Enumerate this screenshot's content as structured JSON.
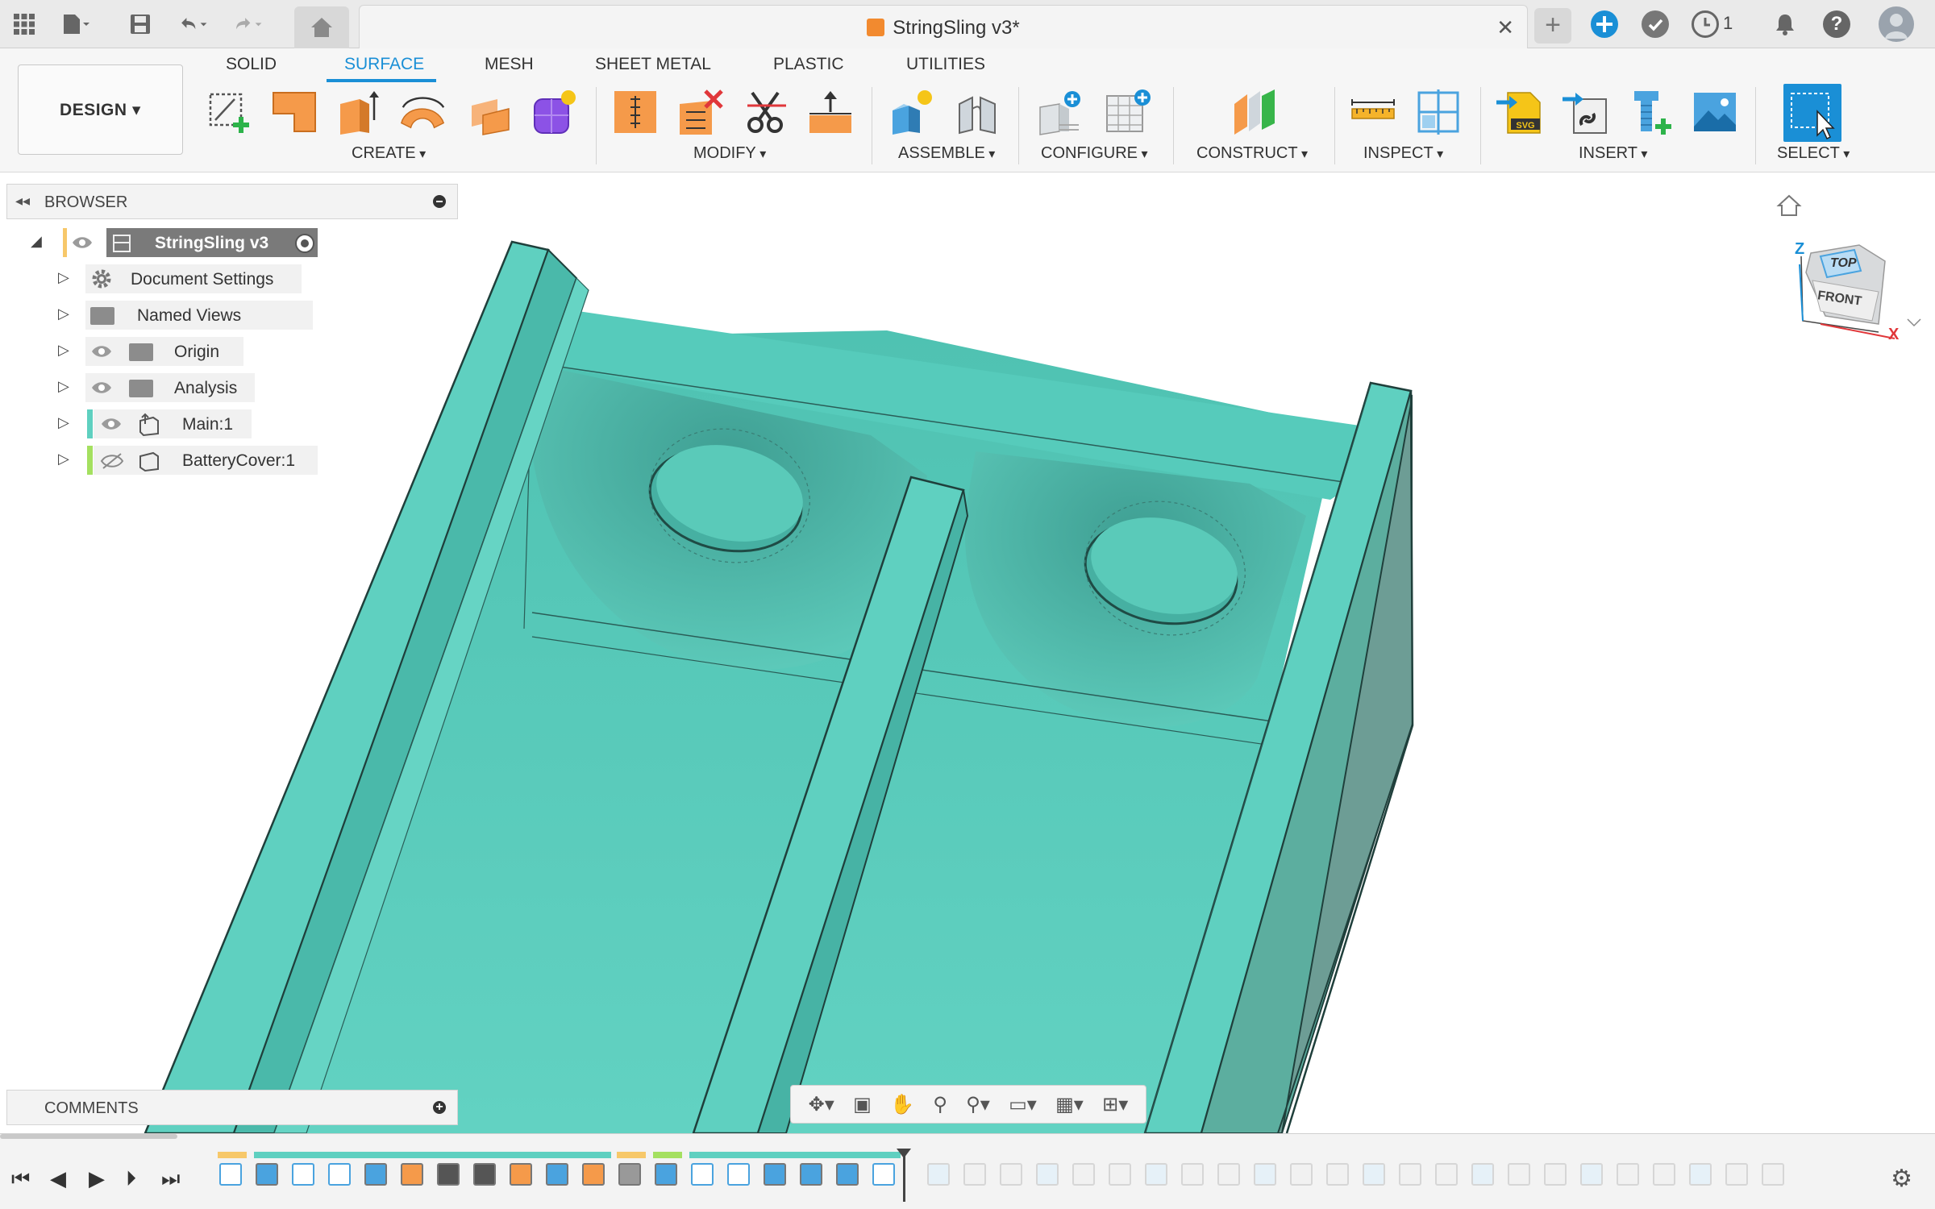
{
  "app": {
    "document_title": "StringSling v3*",
    "notification_count": "1"
  },
  "workspace": {
    "mode_button": "DESIGN ▾",
    "tabs": [
      {
        "label": "SOLID",
        "active": false
      },
      {
        "label": "SURFACE",
        "active": true
      },
      {
        "label": "MESH",
        "active": false
      },
      {
        "label": "SHEET METAL",
        "active": false
      },
      {
        "label": "PLASTIC",
        "active": false
      },
      {
        "label": "UTILITIES",
        "active": false
      }
    ]
  },
  "ribbon": {
    "groups": {
      "create": "CREATE",
      "modify": "MODIFY",
      "assemble": "ASSEMBLE",
      "configure": "CONFIGURE",
      "construct": "CONSTRUCT",
      "inspect": "INSPECT",
      "insert": "INSERT",
      "select": "SELECT"
    }
  },
  "browser": {
    "title": "BROWSER",
    "root": "StringSling v3",
    "items": [
      {
        "label": "Document Settings",
        "icon": "gear-icon"
      },
      {
        "label": "Named Views",
        "icon": "folder-icon"
      },
      {
        "label": "Origin",
        "icon": "folder-icon"
      },
      {
        "label": "Analysis",
        "icon": "folder-icon"
      },
      {
        "label": "Main:1",
        "icon": "component-icon"
      },
      {
        "label": "BatteryCover:1",
        "icon": "component-icon"
      }
    ]
  },
  "comments": {
    "title": "COMMENTS"
  },
  "viewcube": {
    "top": "TOP",
    "front": "FRONT",
    "axis_z": "Z",
    "axis_x": "X"
  },
  "colors": {
    "model_teal": "#5fcfbf",
    "model_teal_dark": "#3fa79a",
    "model_side": "#6f9d95",
    "accent_blue": "#1a8fd6",
    "create_orange": "#f59a4a"
  }
}
